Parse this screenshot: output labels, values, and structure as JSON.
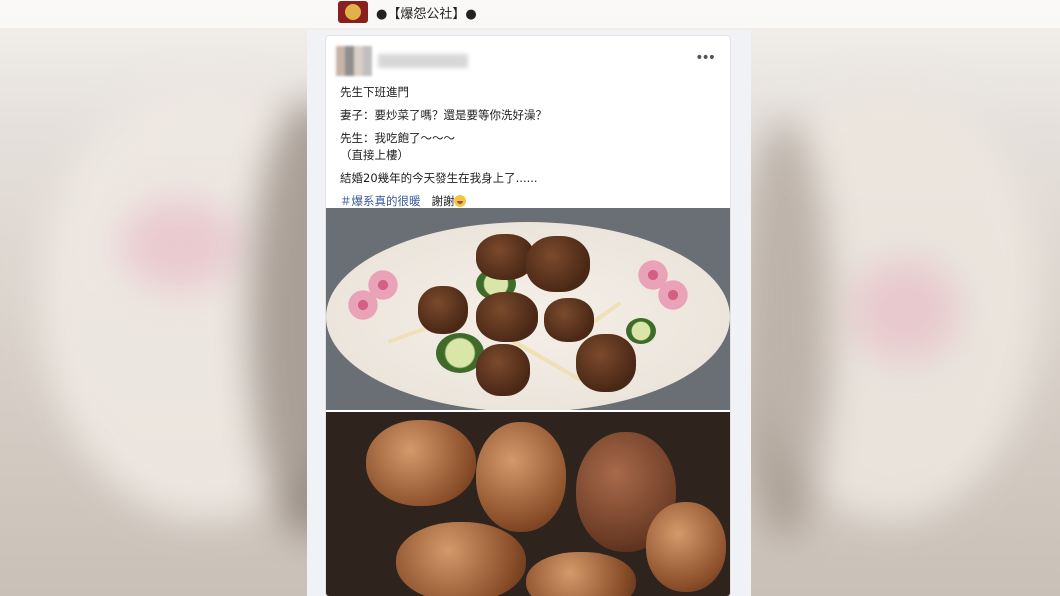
{
  "page": {
    "name": "●【爆怨公社】●"
  },
  "post": {
    "lines": [
      "先生下班進門",
      "妻子：要炒菜了嗎？還是要等你洗好澡？",
      "先生：我吃飽了～～～",
      "（直接上樓）",
      "結婚20幾年的今天發生在我身上了......"
    ],
    "hashtag": "＃爆系真的很暖",
    "thanks": "謝謝"
  },
  "icons": {
    "more": "more-options-icon",
    "emoji": "smiling-face-icon"
  },
  "photos": [
    {
      "alt": "beef cubes with zucchini and onion on floral plate"
    },
    {
      "alt": "braised pork knuckles"
    }
  ]
}
